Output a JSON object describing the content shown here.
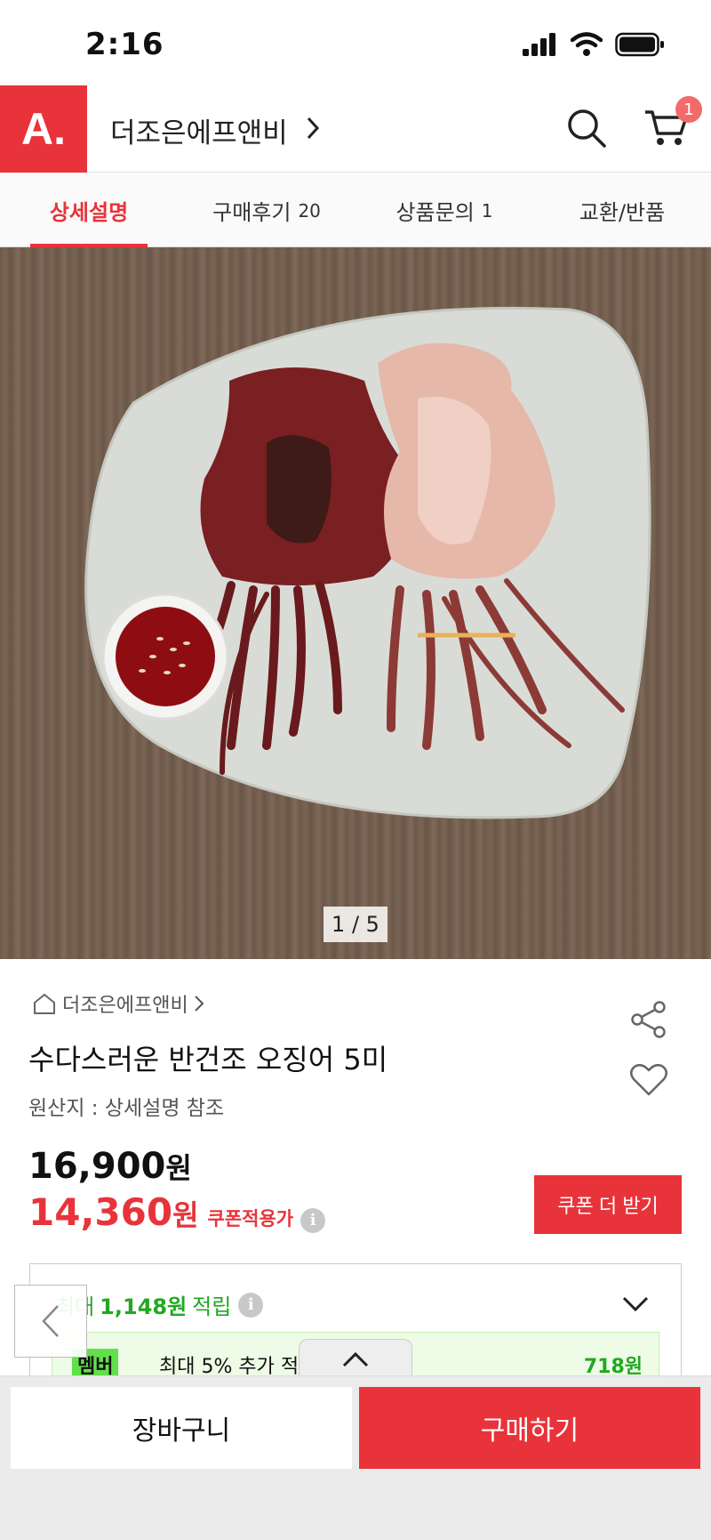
{
  "status_bar": {
    "time": "2:16"
  },
  "header": {
    "logo": "A.",
    "shop_name": "더조은에프앤비",
    "cart_count": "1"
  },
  "tabs": [
    {
      "label": "상세설명",
      "count": ""
    },
    {
      "label": "구매후기",
      "count": "20"
    },
    {
      "label": "상품문의",
      "count": "1"
    },
    {
      "label": "교환/반품",
      "count": ""
    }
  ],
  "hero": {
    "pager": "1 / 5"
  },
  "product": {
    "brand": "더조은에프앤비",
    "title": "수다스러운 반건조 오징어 5미",
    "origin": "원산지 : 상세설명 참조",
    "price_original": "16,900",
    "price_sale": "14,360",
    "currency": "원",
    "coupon_label": "쿠폰적용가",
    "coupon_button": "쿠폰 더 받기"
  },
  "points": {
    "prefix": "최대",
    "amount": "1,148원",
    "suffix": "적립",
    "member_badge": "멤버",
    "member_text": "최대 5% 추가 적",
    "member_amount": "718원"
  },
  "bottom": {
    "cart_label": "장바구니",
    "buy_label": "구매하기"
  },
  "colors": {
    "accent": "#e8333b",
    "points_green": "#22a822"
  }
}
